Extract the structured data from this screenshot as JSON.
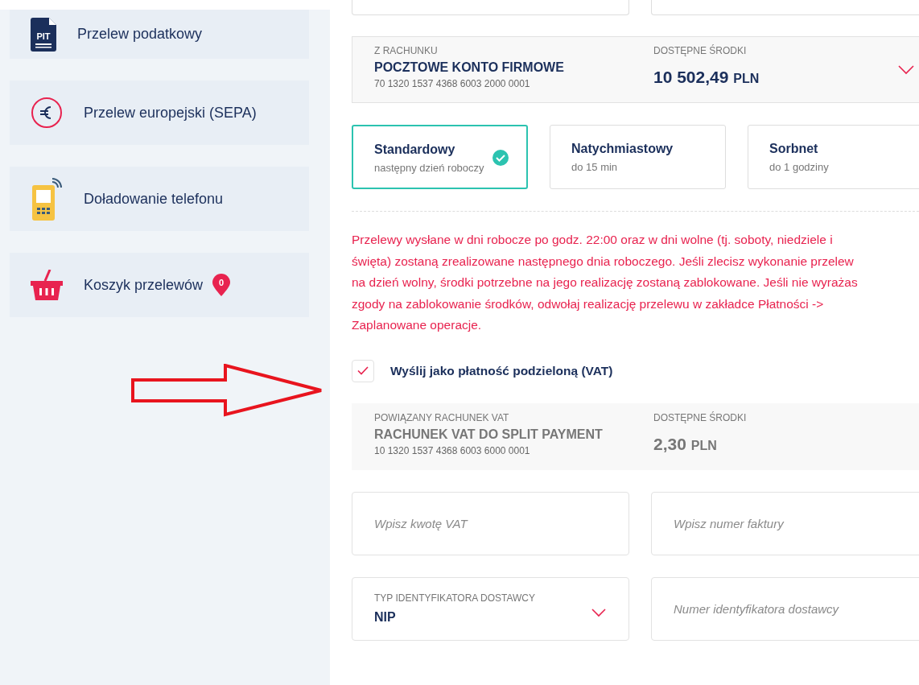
{
  "sidebar": {
    "items": [
      {
        "icon_text": "PIT",
        "label": "Przelew podatkowy"
      },
      {
        "label": "Przelew europejski (SEPA)"
      },
      {
        "label": "Doładowanie telefonu"
      },
      {
        "label": "Koszyk przelewów",
        "badge": "0"
      }
    ]
  },
  "source_account": {
    "label": "Z RACHUNKU",
    "name": "POCZTOWE KONTO FIRMOWE",
    "number": "70 1320 1537 4368 6003 2000 0001",
    "balance_label": "DOSTĘPNE ŚRODKI",
    "balance": "10 502,49",
    "currency": "PLN"
  },
  "transfer_types": [
    {
      "title": "Standardowy",
      "subtitle": "następny dzień roboczy",
      "selected": true
    },
    {
      "title": "Natychmiastowy",
      "subtitle": "do 15 min",
      "selected": false
    },
    {
      "title": "Sorbnet",
      "subtitle": "do 1 godziny",
      "selected": false
    }
  ],
  "notice_lines": [
    "Przelewy wysłane w dni robocze po godz. 22:00 oraz w dni wolne (tj. soboty, niedziele i",
    "święta) zostaną zrealizowane następnego dnia roboczego. Jeśli zlecisz wykonanie przelew",
    "na dzień wolny, środki potrzebne na jego realizację zostaną zablokowane. Jeśli nie wyrażas",
    "zgody na zablokowanie środków, odwołaj realizację przelewu w zakładce Płatności ->",
    "Zaplanowane operacje."
  ],
  "split_payment": {
    "label": "Wyślij jako płatność podzieloną (VAT)",
    "checked": true
  },
  "vat_account": {
    "label": "POWIĄZANY RACHUNEK VAT",
    "name": "RACHUNEK VAT DO SPLIT PAYMENT",
    "number": "10 1320 1537 4368 6003 6000 0001",
    "balance_label": "DOSTĘPNE ŚRODKI",
    "balance": "2,30",
    "currency": "PLN"
  },
  "fields": [
    {
      "kind": "input",
      "placeholder": "Wpisz kwotę VAT"
    },
    {
      "kind": "input",
      "placeholder": "Wpisz numer faktury"
    },
    {
      "kind": "select",
      "label": "TYP IDENTYFIKATORA DOSTAWCY",
      "value": "NIP"
    },
    {
      "kind": "input",
      "placeholder": "Numer identyfikatora dostawcy"
    }
  ]
}
